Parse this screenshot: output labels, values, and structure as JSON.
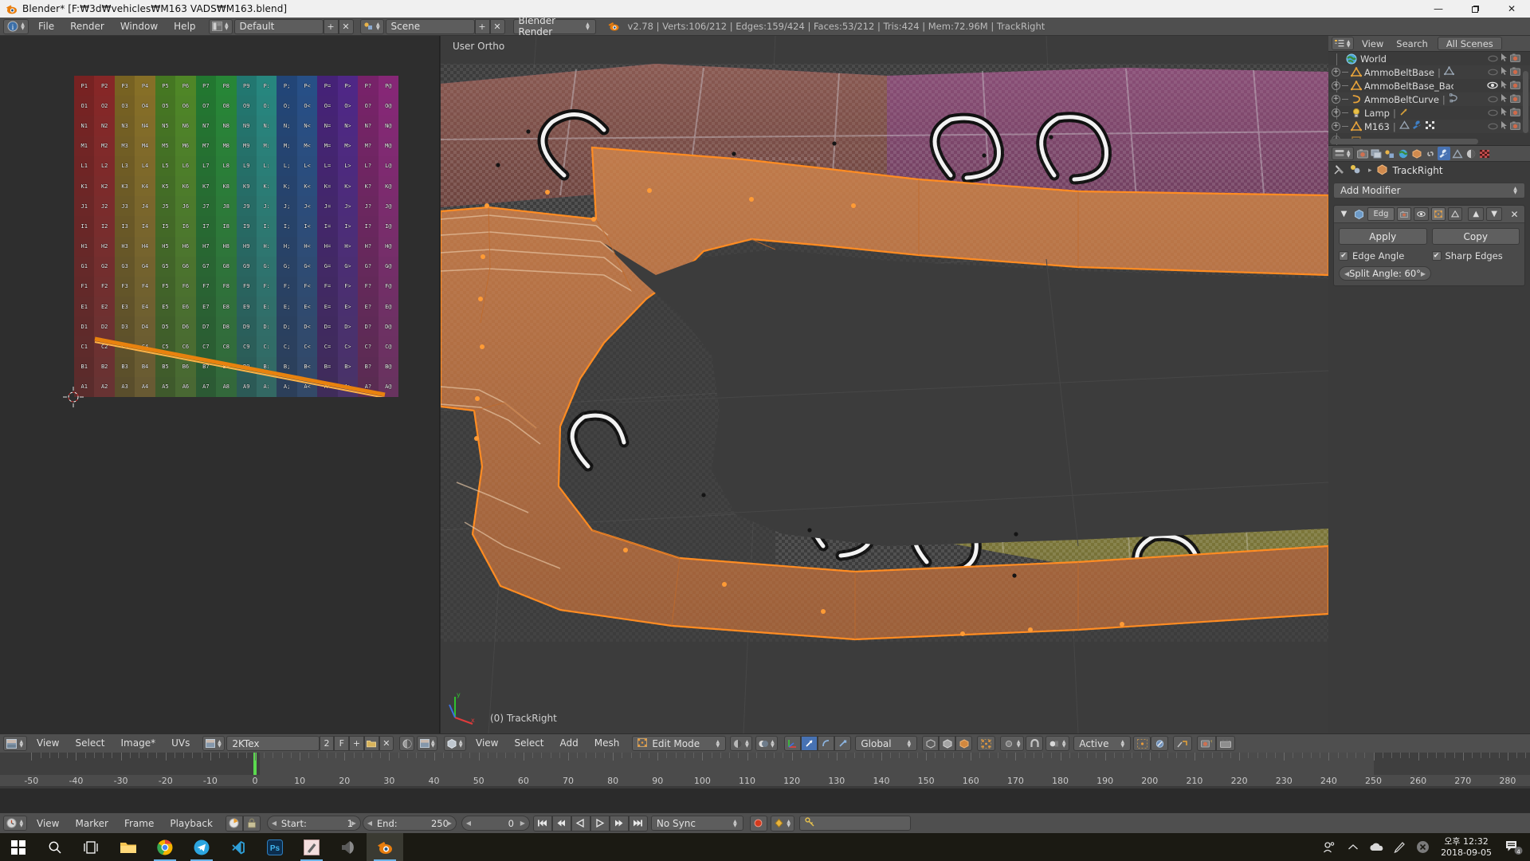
{
  "window": {
    "title": "Blender* [F:₩3d₩vehicles₩M163 VADS₩M163.blend]",
    "app_icon": "blender-logo-icon",
    "minimize_label": "—",
    "maximize_label": "❐",
    "close_label": "✕"
  },
  "topbar": {
    "editor_icon": "info-editor-icon",
    "menus": [
      "File",
      "Render",
      "Window",
      "Help"
    ],
    "screen_layout_icon": "screen-layout-icon",
    "screen_layout": "Default",
    "screen_add_label": "+",
    "screen_del_label": "✕",
    "scene_icon": "scene-icon",
    "scene": "Scene",
    "scene_add_label": "+",
    "scene_del_label": "✕",
    "render_engine": "Blender Render",
    "blender_icon": "blender-logo-icon",
    "stats": "v2.78 | Verts:106/212 | Edges:159/424 | Faces:53/212 | Tris:424 | Mem:72.96M | TrackRight"
  },
  "uv_editor": {
    "image_name": "2KTex",
    "users_count": "2",
    "fake_user_label": "F",
    "new_label": "+",
    "open_icon": "folder-open-icon",
    "unlink_label": "✕",
    "menus": [
      "View",
      "Select",
      "Image*",
      "UVs"
    ],
    "editor_icon": "uv-image-editor-icon",
    "image_browse_icon": "image-browse-icon",
    "render_result_icon": "render-result-icon",
    "pivot_icon": "pivot-icon",
    "uv_grid": {
      "rows": 16,
      "cols": 16,
      "row_letters": [
        "P",
        "O",
        "N",
        "M",
        "L",
        "K",
        "J",
        "I",
        "H",
        "G",
        "F",
        "E",
        "D",
        "C",
        "B",
        "A"
      ],
      "col_labels": [
        "1",
        "2",
        "3",
        "4",
        "5",
        "6",
        "7",
        "8",
        "9",
        ":",
        ";",
        "<",
        "=",
        ">",
        "?",
        "@"
      ],
      "column_hues": [
        0,
        0,
        45,
        45,
        95,
        95,
        130,
        130,
        175,
        175,
        215,
        215,
        265,
        265,
        310,
        310
      ]
    }
  },
  "viewport": {
    "view_label": "User Ortho",
    "object_label": "(0) TrackRight",
    "editor_icon": "3d-view-icon",
    "menus": [
      "View",
      "Select",
      "Add",
      "Mesh"
    ],
    "mode": "Edit Mode",
    "mode_icon": "edit-mode-icon",
    "shading_icon": "viewport-shading-icon",
    "draw_type_icon": "draw-type-icon",
    "select_modes": [
      "vertex-select-icon",
      "edge-select-icon",
      "face-select-icon"
    ],
    "manipulator_icons": [
      "manipulator-toggle-icon",
      "translate-manipulator-icon",
      "rotate-manipulator-icon",
      "scale-manipulator-icon"
    ],
    "transform_orientation": "Global",
    "layer_icons": [
      "occlude-geometry-icon",
      "limit-selection-icon",
      "texture-solid-icon"
    ],
    "snap_icons": [
      "snap-element-icon",
      "snap-magnet-icon"
    ],
    "proportional_edit": "Active",
    "proportional_icons": [
      "proportional-edit-icon",
      "falloff-icon"
    ],
    "extra_icons": [
      "pivot-center-icon",
      "render-ops-icon",
      "opengl-render-icon"
    ]
  },
  "outliner": {
    "editor_icon": "outliner-icon",
    "menus": [
      "View",
      "Search"
    ],
    "display_mode": "All Scenes",
    "items": [
      {
        "name": "World",
        "icon": "world-icon",
        "expandable": false,
        "datablock_icons": [],
        "visible": false,
        "selectable": true,
        "renderable": true
      },
      {
        "name": "AmmoBeltBase",
        "icon": "mesh-object-icon",
        "expandable": true,
        "datablock_icons": [
          "mesh-data-icon"
        ],
        "visible": false,
        "selectable": true,
        "renderable": true
      },
      {
        "name": "AmmoBeltBase_Backup",
        "icon": "mesh-object-icon",
        "expandable": true,
        "datablock_icons": [],
        "visible": true,
        "selectable": true,
        "renderable": true
      },
      {
        "name": "AmmoBeltCurve",
        "icon": "curve-object-icon",
        "expandable": true,
        "datablock_icons": [
          "curve-data-icon"
        ],
        "visible": false,
        "selectable": true,
        "renderable": true
      },
      {
        "name": "Lamp",
        "icon": "lamp-object-icon",
        "expandable": true,
        "datablock_icons": [
          "lamp-data-icon"
        ],
        "visible": false,
        "selectable": true,
        "renderable": true
      },
      {
        "name": "M163",
        "icon": "mesh-object-icon",
        "expandable": true,
        "datablock_icons": [
          "mesh-data-icon",
          "modifier-wrench-icon",
          "vertex-group-icon"
        ],
        "visible": false,
        "selectable": true,
        "renderable": true
      }
    ]
  },
  "properties": {
    "tabs": [
      {
        "icon": "render-tab-icon",
        "active": false
      },
      {
        "icon": "render-layers-tab-icon",
        "active": false
      },
      {
        "icon": "scene-tab-icon",
        "active": false
      },
      {
        "icon": "world-tab-icon",
        "active": false
      },
      {
        "icon": "object-tab-icon",
        "active": false
      },
      {
        "icon": "constraints-tab-icon",
        "active": false
      },
      {
        "icon": "modifier-wrench-tab-icon",
        "active": true
      },
      {
        "icon": "object-data-tab-icon",
        "active": false
      },
      {
        "icon": "material-tab-icon",
        "active": false
      },
      {
        "icon": "texture-tab-icon",
        "active": false
      }
    ],
    "breadcrumb_pin_icon": "pin-icon",
    "breadcrumb_obj_icon": "object-icon",
    "breadcrumb_separator": "▸",
    "breadcrumb_name": "TrackRight",
    "add_modifier_label": "Add Modifier",
    "modifier": {
      "collapse_icon": "collapse-triangle-icon",
      "type_icon": "edge-split-modifier-icon",
      "name": "Edg",
      "toggle_icons": [
        "render-toggle-icon",
        "realtime-toggle-icon",
        "edit-mode-toggle-icon",
        "cage-toggle-icon"
      ],
      "move_up_label": "▲",
      "move_down_label": "▼",
      "delete_label": "✕",
      "apply_label": "Apply",
      "copy_label": "Copy",
      "edge_angle_label": "Edge Angle",
      "edge_angle_checked": true,
      "sharp_edges_label": "Sharp Edges",
      "sharp_edges_checked": true,
      "split_angle_label": "Split Angle: 60°"
    }
  },
  "timeline": {
    "editor_icon": "timeline-icon",
    "menus": [
      "View",
      "Marker",
      "Frame",
      "Playback"
    ],
    "use_preview_icon": "preview-range-icon",
    "lock_icon": "lock-icon",
    "start_label": "Start:",
    "start_value": "1",
    "end_label": "End:",
    "end_value": "250",
    "current_frame": "0",
    "transport_icons": [
      "jump-to-start-icon",
      "jump-prev-keyframe-icon",
      "play-reverse-icon",
      "play-icon",
      "jump-next-keyframe-icon",
      "jump-to-end-icon"
    ],
    "sync_mode": "No Sync",
    "record_icon": "record-icon",
    "keyframe_type_icon": "keyframe-diamond-icon",
    "keying_set_icon": "keying-set-icon",
    "ruler_ticks": [
      -50,
      -40,
      -30,
      -20,
      -10,
      0,
      10,
      20,
      30,
      40,
      50,
      60,
      70,
      80,
      90,
      100,
      110,
      120,
      130,
      140,
      150,
      160,
      170,
      180,
      190,
      200,
      210,
      220,
      230,
      240,
      250,
      260,
      270,
      280
    ],
    "range_start": 1,
    "range_end": 250,
    "playhead_frame": 0,
    "view_min": -57,
    "view_max": 285
  },
  "taskbar": {
    "items": [
      {
        "icon": "windows-start-icon",
        "running": false,
        "active": false
      },
      {
        "icon": "search-icon",
        "running": false,
        "active": false
      },
      {
        "icon": "task-view-icon",
        "running": false,
        "active": false
      },
      {
        "icon": "file-explorer-icon",
        "running": false,
        "active": false
      },
      {
        "icon": "chrome-icon",
        "running": true,
        "active": false
      },
      {
        "icon": "telegram-icon",
        "running": true,
        "active": false
      },
      {
        "icon": "vscode-icon",
        "running": false,
        "active": false
      },
      {
        "icon": "photoshop-icon",
        "running": false,
        "active": false
      },
      {
        "icon": "paint-tool-sai-icon",
        "running": true,
        "active": false
      },
      {
        "icon": "speaker-icon",
        "running": false,
        "active": false
      },
      {
        "icon": "blender-icon",
        "running": true,
        "active": true
      }
    ],
    "tray_icons": [
      "people-icon",
      "chevron-up-icon",
      "onedrive-icon",
      "pen-icon",
      "close-circle-icon"
    ],
    "clock_time": "오후 12:32",
    "clock_date": "2018-09-05",
    "notification_icon": "notification-icon",
    "notification_count": "4"
  }
}
